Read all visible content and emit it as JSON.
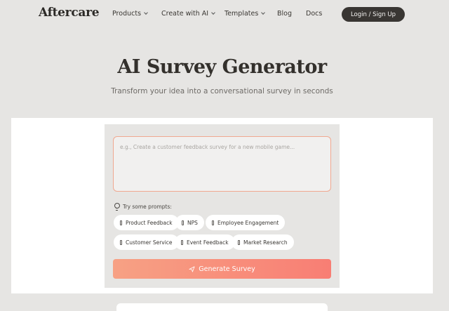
{
  "nav": {
    "logo": "Aftercare",
    "items": [
      {
        "label": "Products",
        "dropdown": true
      },
      {
        "label": "Create with AI",
        "dropdown": true
      },
      {
        "label": "Templates",
        "dropdown": true
      },
      {
        "label": "Blog",
        "dropdown": false
      },
      {
        "label": "Docs",
        "dropdown": false
      }
    ],
    "login_label": "Login / Sign Up"
  },
  "hero": {
    "title": "AI Survey Generator",
    "subtitle": "Transform your idea into a conversational survey in seconds"
  },
  "generator": {
    "prompt_placeholder": "e.g., Create a customer feedback survey for a new mobile game...",
    "prompt_value": "",
    "try_label": "Try some prompts:",
    "chips": [
      "Product Feedback",
      "NPS",
      "Employee Engagement",
      "Customer Service",
      "Event Feedback",
      "Market Research"
    ],
    "generate_label": "Generate Survey"
  },
  "colors": {
    "accent_start": "#f7a184",
    "accent_end": "#f87e74",
    "dark_button": "#393633",
    "background": "#e6e5e3"
  }
}
